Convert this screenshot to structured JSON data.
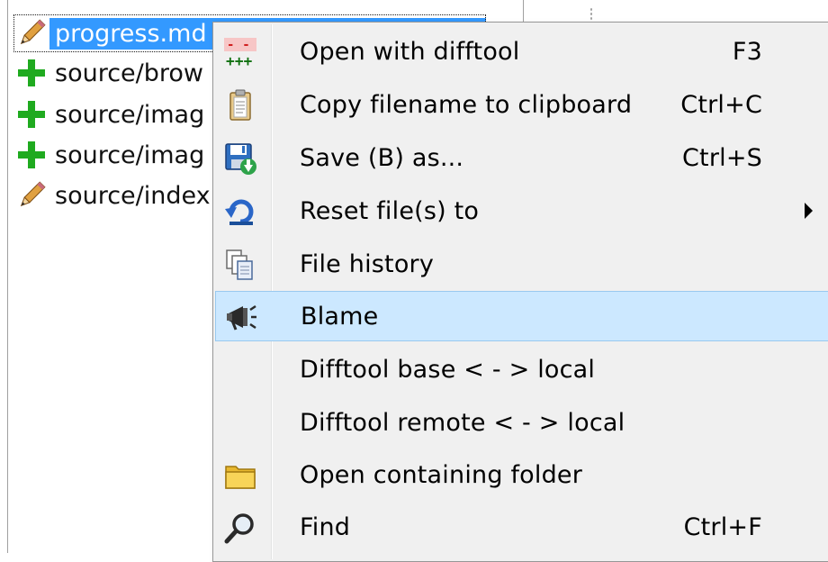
{
  "file_list": {
    "items": [
      {
        "status_icon": "pencil-icon",
        "name": "progress.md",
        "selected": true
      },
      {
        "status_icon": "plus-icon",
        "name": "source/brow",
        "selected": false
      },
      {
        "status_icon": "plus-icon",
        "name": "source/imag",
        "selected": false
      },
      {
        "status_icon": "plus-icon",
        "name": "source/imag",
        "selected": false
      },
      {
        "status_icon": "pencil-icon",
        "name": "source/index",
        "selected": false
      }
    ]
  },
  "context_menu": {
    "items": [
      {
        "icon": "diff-icon",
        "label": "Open with difftool",
        "shortcut": "F3"
      },
      {
        "icon": "clipboard-icon",
        "label": "Copy filename to clipboard",
        "shortcut": "Ctrl+C"
      },
      {
        "icon": "save-icon",
        "label": "Save (B) as...",
        "shortcut": "Ctrl+S"
      },
      {
        "icon": "reset-icon",
        "label": "Reset file(s) to",
        "shortcut": "",
        "submenu": true
      },
      {
        "icon": "file-history-icon",
        "label": "File history",
        "shortcut": ""
      },
      {
        "icon": "blame-icon",
        "label": "Blame",
        "shortcut": "",
        "highlighted": true
      },
      {
        "icon": "",
        "label": "Difftool base < - > local",
        "shortcut": ""
      },
      {
        "icon": "",
        "label": "Difftool remote < - > local",
        "shortcut": ""
      },
      {
        "icon": "folder-icon",
        "label": "Open containing folder",
        "shortcut": ""
      },
      {
        "icon": "find-icon",
        "label": "Find",
        "shortcut": "Ctrl+F"
      }
    ]
  },
  "colors": {
    "selection": "#3399ff",
    "menu_highlight": "#cce8ff",
    "menu_background": "#f0f0f0",
    "added_green": "#1faa1f"
  }
}
